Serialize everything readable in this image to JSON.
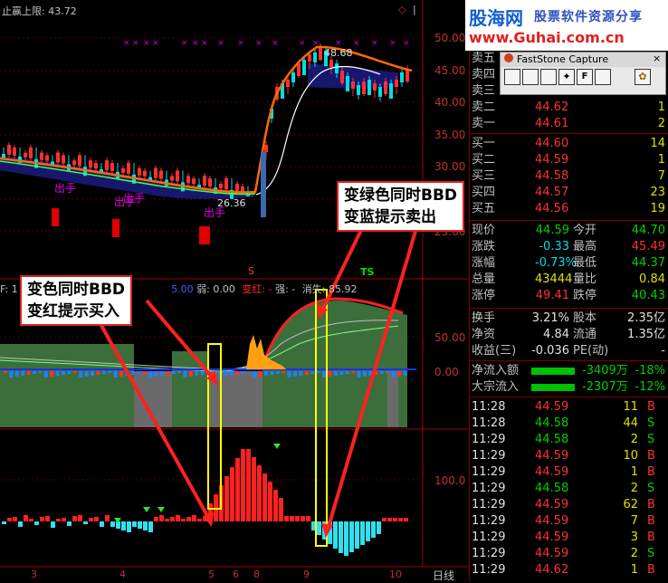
{
  "chart": {
    "header_label": "止赢上限:",
    "header_value": "43.72",
    "price_labels": [
      "50.00",
      "45.00",
      "40.00",
      "35.00",
      "30.00",
      "25.00"
    ],
    "peak_label": "48.68",
    "low_label": "26.36",
    "sell_marks": [
      "出手",
      "出手",
      "出手",
      "出手"
    ],
    "indicator_header": {
      "prefix": "F: 1",
      "val": "5.00",
      "weak_label": "弱:",
      "weak_value": "0.00",
      "change_red": "变红: -",
      "strong": "强: -",
      "vanish": "消失:",
      "vanish_value": "85.92"
    },
    "mid_labels": [
      "50.00",
      "0.00"
    ],
    "low_axis_label": "100.0",
    "s_mark": "S",
    "ts_mark": "TS",
    "date_labels": [
      "3",
      "4",
      "5",
      "6",
      "8",
      "9",
      "10"
    ],
    "period": "日线"
  },
  "annotations": {
    "buy_note_line1": "变色同时BBD",
    "buy_note_line2": "变红提示买入",
    "sell_note_line1": "变绿色同时BBD",
    "sell_note_line2": "变蓝提示卖出"
  },
  "logo": {
    "name": "股海网",
    "slogan": "股票软件资源分享",
    "url": "www.Guhai.com.cn"
  },
  "capture_window": {
    "title": "FastStone Capture"
  },
  "order_book": [
    {
      "label": "卖五",
      "price": "",
      "vol": ""
    },
    {
      "label": "卖四",
      "price": "",
      "vol": ""
    },
    {
      "label": "卖三",
      "price": "",
      "vol": ""
    },
    {
      "label": "卖二",
      "price": "44.62",
      "vol": "1"
    },
    {
      "label": "卖一",
      "price": "44.61",
      "vol": "2"
    },
    {
      "label": "买一",
      "price": "44.60",
      "vol": "14"
    },
    {
      "label": "买二",
      "price": "44.59",
      "vol": "1"
    },
    {
      "label": "买三",
      "price": "44.58",
      "vol": "7"
    },
    {
      "label": "买四",
      "price": "44.57",
      "vol": "23"
    },
    {
      "label": "买五",
      "price": "44.56",
      "vol": "19"
    }
  ],
  "stats": [
    {
      "l1": "现价",
      "v1": "44.59",
      "l2": "今开",
      "v2": "44.70"
    },
    {
      "l1": "涨跌",
      "v1": "-0.33",
      "l2": "最高",
      "v2": "45.49"
    },
    {
      "l1": "涨幅",
      "v1": "-0.73%",
      "l2": "最低",
      "v2": "44.37"
    },
    {
      "l1": "总量",
      "v1": "43444",
      "l2": "量比",
      "v2": "0.84"
    },
    {
      "l1": "涨停",
      "v1": "49.41",
      "l2": "跌停",
      "v2": "40.43"
    }
  ],
  "stats2": [
    {
      "l1": "换手",
      "v1": "3.21%",
      "l2": "股本",
      "v2": "2.35亿"
    },
    {
      "l1": "净资",
      "v1": "4.84",
      "l2": "流通",
      "v2": "1.35亿"
    },
    {
      "l1": "收益(三)",
      "v1": "-0.036",
      "l2": "PE(动)",
      "v2": "-"
    }
  ],
  "flows": [
    {
      "label": "净流入额",
      "value": "-3409万",
      "pct": "-18%"
    },
    {
      "label": "大宗流入",
      "value": "-2307万",
      "pct": "-12%"
    }
  ],
  "ticks": [
    {
      "time": "11:28",
      "price": "44.59",
      "vol": "11",
      "side": "B"
    },
    {
      "time": "11:28",
      "price": "44.58",
      "vol": "44",
      "side": "S"
    },
    {
      "time": "11:29",
      "price": "44.58",
      "vol": "2",
      "side": "S"
    },
    {
      "time": "11:29",
      "price": "44.59",
      "vol": "10",
      "side": "B"
    },
    {
      "time": "11:29",
      "price": "44.59",
      "vol": "1",
      "side": "B"
    },
    {
      "time": "11:29",
      "price": "44.58",
      "vol": "2",
      "side": "S"
    },
    {
      "time": "11:29",
      "price": "44.59",
      "vol": "62",
      "side": "B"
    },
    {
      "time": "11:29",
      "price": "44.59",
      "vol": "7",
      "side": "B"
    },
    {
      "time": "11:29",
      "price": "44.59",
      "vol": "3",
      "side": "B"
    },
    {
      "time": "11:29",
      "price": "44.59",
      "vol": "2",
      "side": "S"
    },
    {
      "time": "11:29",
      "price": "44.62",
      "vol": "1",
      "side": "B"
    }
  ],
  "colors": {
    "up": "#ff3030",
    "down": "#00e0e0",
    "flat": "#e0e0e0",
    "label": "#c0c0c0",
    "green": "#00d000"
  }
}
